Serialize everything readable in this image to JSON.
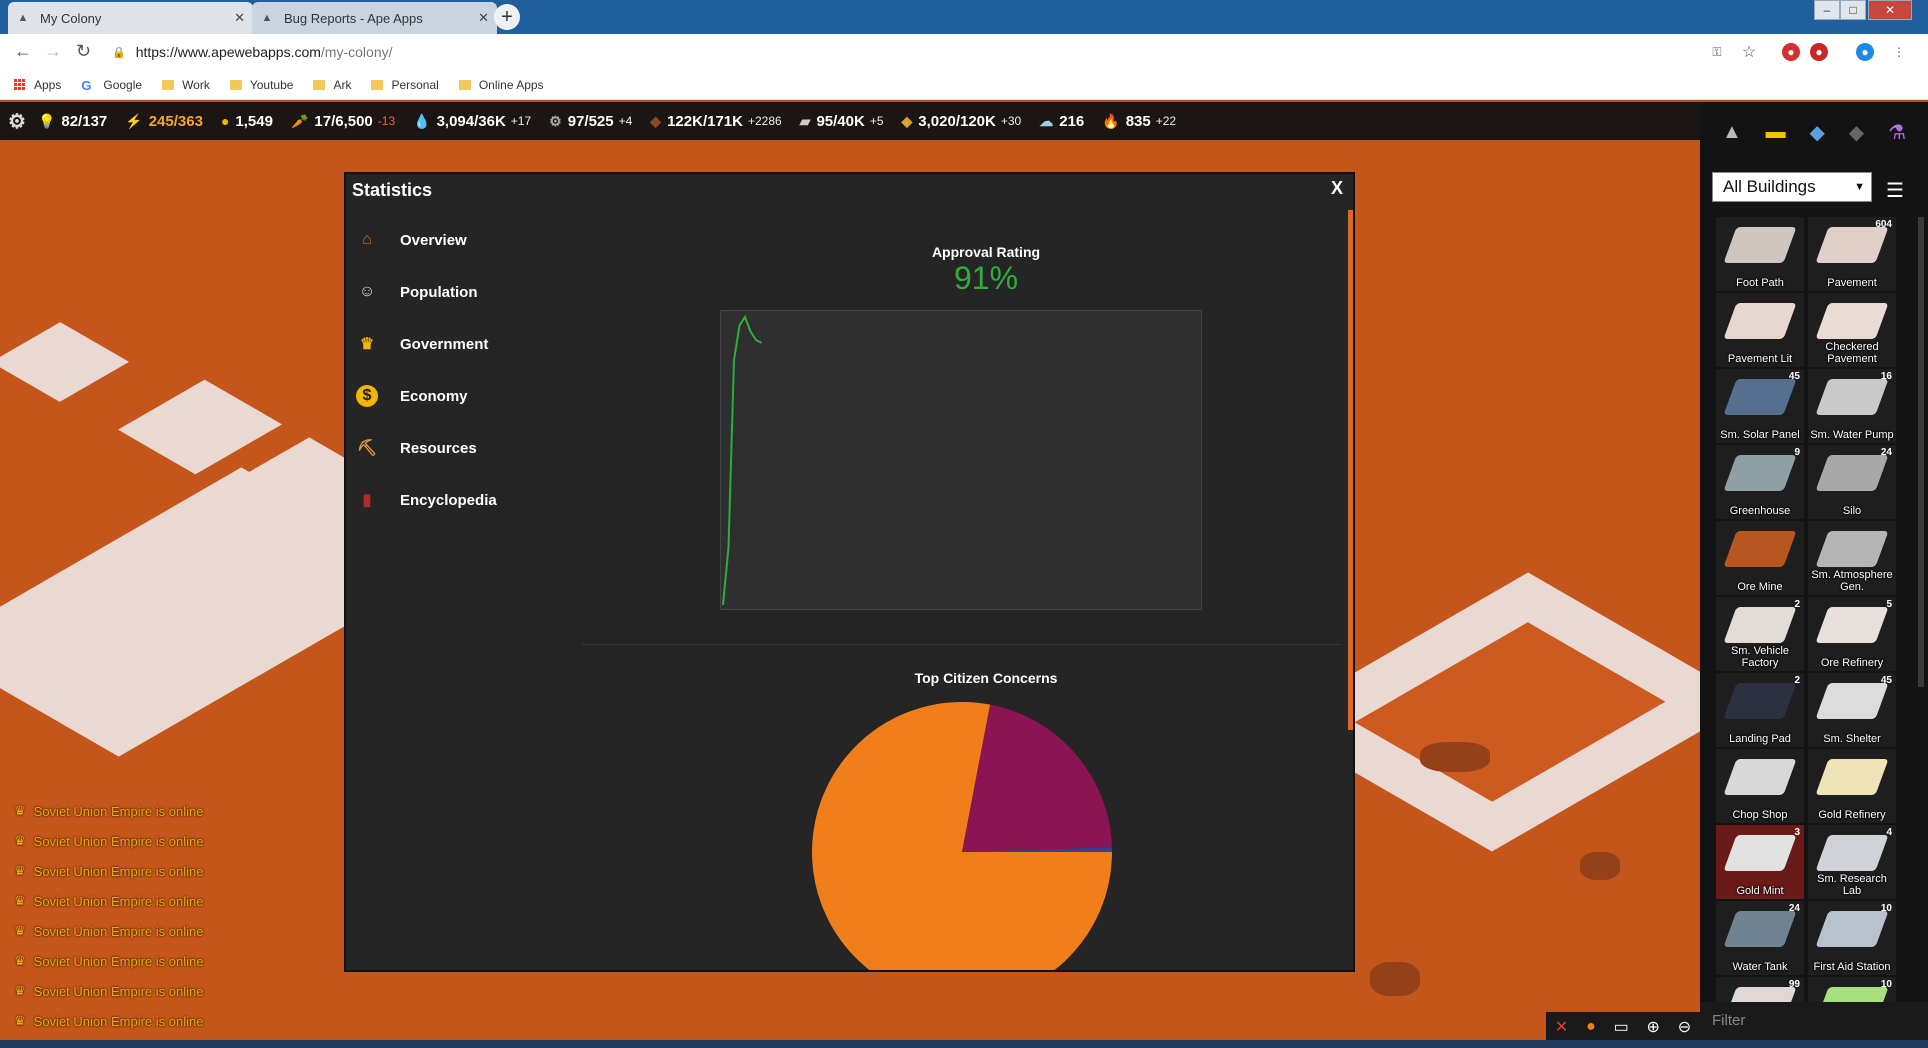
{
  "browser": {
    "tabs": [
      {
        "title": "My Colony",
        "active": true
      },
      {
        "title": "Bug Reports - Ape Apps",
        "active": false
      }
    ],
    "url_host": "https://www.apewebapps.com",
    "url_path": "/my-colony/",
    "bookmarks": [
      "Apps",
      "Google",
      "Work",
      "Youtube",
      "Ark",
      "Personal",
      "Online Apps"
    ]
  },
  "resources": [
    {
      "icon": "lightbulb-icon",
      "glyph": "💡",
      "value": "82/137",
      "delta": "",
      "color": "#ffffff"
    },
    {
      "icon": "energy-icon",
      "glyph": "⚡",
      "value": "245/363",
      "delta": "",
      "color": "#f5a623"
    },
    {
      "icon": "money-icon",
      "glyph": "●",
      "value": "1,549",
      "delta": "",
      "color": "#ffffff"
    },
    {
      "icon": "food-icon",
      "glyph": "🥕",
      "value": "17/6,500",
      "delta": "-13",
      "color": "#ffffff"
    },
    {
      "icon": "water-icon",
      "glyph": "💧",
      "value": "3,094/36K",
      "delta": "+17",
      "color": "#ffffff"
    },
    {
      "icon": "gear-resource-icon",
      "glyph": "⚙",
      "value": "97/525",
      "delta": "+4",
      "color": "#ffffff"
    },
    {
      "icon": "ore-icon",
      "glyph": "◆",
      "value": "122K/171K",
      "delta": "+2286",
      "color": "#ffffff"
    },
    {
      "icon": "aluminum-icon",
      "glyph": "▰",
      "value": "95/40K",
      "delta": "+5",
      "color": "#ffffff"
    },
    {
      "icon": "gold-icon",
      "glyph": "◆",
      "value": "3,020/120K",
      "delta": "+30",
      "color": "#ffffff"
    },
    {
      "icon": "research-icon",
      "glyph": "☁",
      "value": "216",
      "delta": "",
      "color": "#ffffff"
    },
    {
      "icon": "fire-icon",
      "glyph": "🔥",
      "value": "835",
      "delta": "+22",
      "color": "#ffffff"
    }
  ],
  "statistics": {
    "title": "Statistics",
    "close_label": "X",
    "menu": [
      {
        "label": "Overview",
        "icon": "home-icon",
        "glyph": "⌂",
        "color": "#d96a1f"
      },
      {
        "label": "Population",
        "icon": "people-icon",
        "glyph": "☺",
        "color": "#dddddd"
      },
      {
        "label": "Government",
        "icon": "crown-icon",
        "glyph": "♛",
        "color": "#f2b600"
      },
      {
        "label": "Economy",
        "icon": "coin-icon",
        "glyph": "$",
        "color": "#f2b600"
      },
      {
        "label": "Resources",
        "icon": "resources-icon",
        "glyph": "⛏",
        "color": "#e6a040"
      },
      {
        "label": "Encyclopedia",
        "icon": "book-icon",
        "glyph": "▮",
        "color": "#b02a2a"
      }
    ],
    "approval_title": "Approval Rating",
    "approval_value": "91%",
    "concerns_title": "Top Citizen Concerns"
  },
  "chart_data": [
    {
      "type": "line",
      "title": "Approval Rating",
      "series": [
        {
          "values": [
            0,
            20,
            85,
            97,
            100,
            95,
            92,
            91
          ]
        }
      ],
      "ylim": [
        0,
        100
      ],
      "grid": false,
      "colors": [
        "#2fae3c"
      ]
    },
    {
      "type": "pie",
      "title": "Top Citizen Concerns",
      "values": [
        78,
        21.5,
        0.5
      ],
      "colors": [
        "#f07e1a",
        "#8c1454",
        "#3a3f8a"
      ]
    }
  ],
  "right_panel": {
    "filter_select": "All Buildings",
    "filter_placeholder": "Filter",
    "buildings": [
      {
        "name": "Foot Path",
        "count": "",
        "color": "#cfc6bf",
        "selected": false
      },
      {
        "name": "Pavement",
        "count": "604",
        "color": "#e0d0c8",
        "selected": false
      },
      {
        "name": "Pavement Lit",
        "count": "",
        "color": "#e6d8d0",
        "selected": false
      },
      {
        "name": "Checkered Pavement",
        "count": "",
        "color": "#e8dcd4",
        "selected": false
      },
      {
        "name": "Sm. Solar Panel",
        "count": "45",
        "color": "#55708f",
        "selected": false
      },
      {
        "name": "Sm. Water Pump",
        "count": "16",
        "color": "#c9c9c9",
        "selected": false
      },
      {
        "name": "Greenhouse",
        "count": "9",
        "color": "#8e9fa6",
        "selected": false
      },
      {
        "name": "Silo",
        "count": "24",
        "color": "#a8a8a8",
        "selected": false
      },
      {
        "name": "Ore Mine",
        "count": "",
        "color": "#b8561f",
        "selected": false
      },
      {
        "name": "Sm. Atmosphere Gen.",
        "count": "",
        "color": "#b5b5b5",
        "selected": false
      },
      {
        "name": "Sm. Vehicle Factory",
        "count": "2",
        "color": "#e3dbd6",
        "selected": false
      },
      {
        "name": "Ore Refinery",
        "count": "5",
        "color": "#e8e0dc",
        "selected": false
      },
      {
        "name": "Landing Pad",
        "count": "2",
        "color": "#2b3140",
        "selected": false
      },
      {
        "name": "Sm. Shelter",
        "count": "45",
        "color": "#dcdcdc",
        "selected": false
      },
      {
        "name": "Chop Shop",
        "count": "",
        "color": "#d8d8d8",
        "selected": false
      },
      {
        "name": "Gold Refinery",
        "count": "",
        "color": "#efe3b8",
        "selected": false
      },
      {
        "name": "Gold Mint",
        "count": "3",
        "color": "#e2e2e2",
        "selected": true
      },
      {
        "name": "Sm. Research Lab",
        "count": "4",
        "color": "#cfd3d8",
        "selected": false
      },
      {
        "name": "Water Tank",
        "count": "24",
        "color": "#6f8392",
        "selected": false
      },
      {
        "name": "First Aid Station",
        "count": "10",
        "color": "#b8c2cc",
        "selected": false
      },
      {
        "name": "",
        "count": "99",
        "color": "#e0d8d2",
        "selected": false
      },
      {
        "name": "",
        "count": "10",
        "color": "#a8e080",
        "selected": false
      }
    ]
  },
  "chat": {
    "messages": [
      "Soviet Union Empire is online",
      "Soviet Union Empire is online",
      "Soviet Union Empire is online",
      "Soviet Union Empire is online",
      "Soviet Union Empire is online",
      "Soviet Union Empire is online",
      "Soviet Union Empire is online",
      "Soviet Union Empire is online"
    ]
  }
}
